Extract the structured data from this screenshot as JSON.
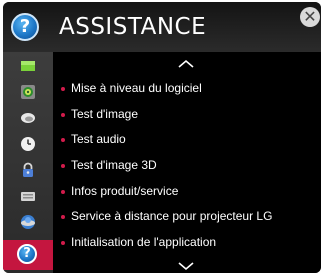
{
  "header": {
    "title": "ASSISTANCE",
    "icon": "question-circle-icon",
    "help_glyph": "?",
    "close_glyph": "✕"
  },
  "sidebar": {
    "items": [
      {
        "name": "picture-icon",
        "label": ""
      },
      {
        "name": "speaker-icon",
        "label": ""
      },
      {
        "name": "satellite-dish-icon",
        "label": ""
      },
      {
        "name": "clock-icon",
        "label": ""
      },
      {
        "name": "lock-icon",
        "label": ""
      },
      {
        "name": "keyboard-icon",
        "label": ""
      },
      {
        "name": "network-globe-icon",
        "label": ""
      },
      {
        "name": "support-question-icon",
        "label": "?",
        "active": true
      }
    ]
  },
  "menu": {
    "items": [
      "Mise à niveau du logiciel",
      "Test d'image",
      "Test audio",
      "Test d'image 3D",
      "Infos produit/service",
      "Service à distance pour projecteur LG",
      "Initialisation de l'application"
    ],
    "scroll_up_icon": "chevron-up-icon",
    "scroll_down_icon": "chevron-down-icon"
  },
  "colors": {
    "bullet": "#d21b4b",
    "active_tab": "#c4163f",
    "content_bg": "#000000",
    "sidebar_bg": "#333333",
    "text": "#ffffff"
  }
}
